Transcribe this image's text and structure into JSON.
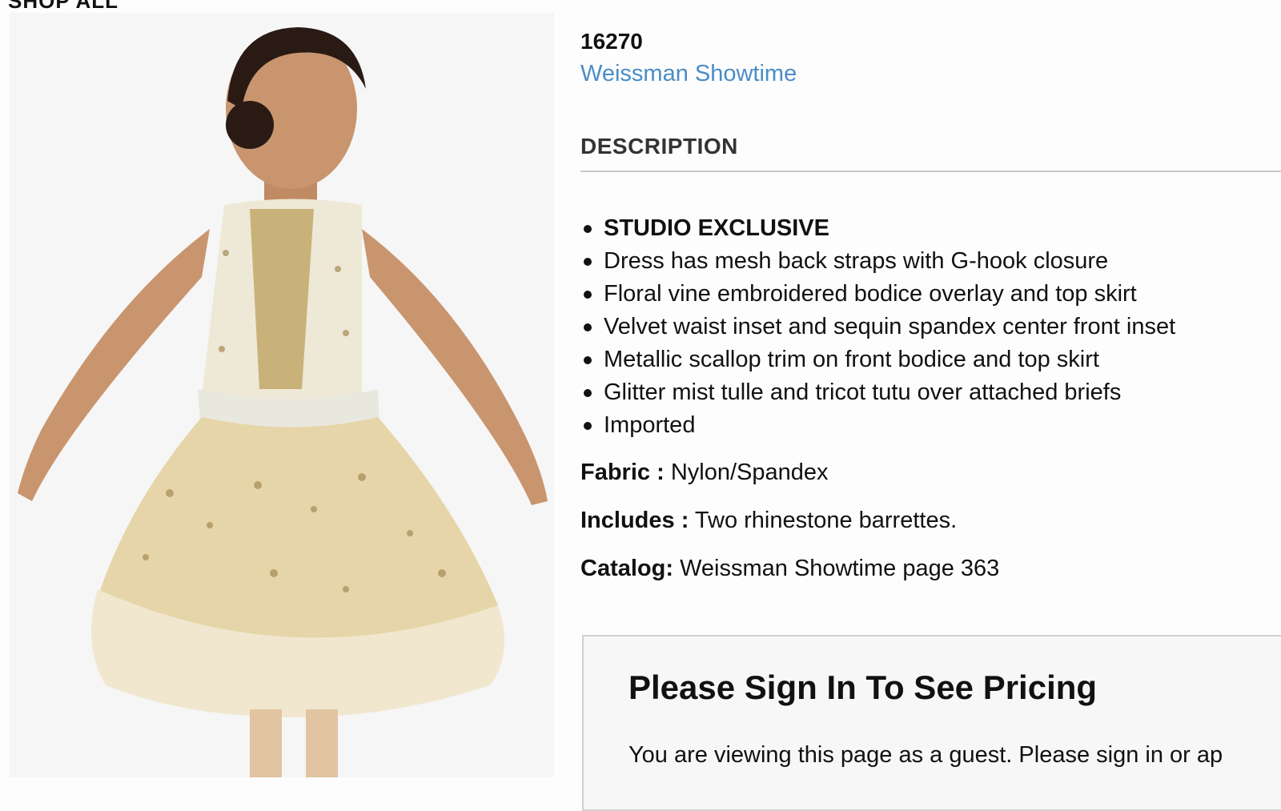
{
  "page": {
    "crumb": "SHOP ALL"
  },
  "product": {
    "sku": "16270",
    "brand": "Weissman Showtime",
    "image_alt": "Girl in cream and gold sequin ballet costume"
  },
  "description": {
    "heading": "DESCRIPTION",
    "bullets": [
      "STUDIO EXCLUSIVE",
      "Dress has mesh back straps with G-hook closure",
      "Floral vine embroidered bodice overlay and top skirt",
      "Velvet waist inset and sequin spandex center front inset",
      "Metallic scallop trim on front bodice and top skirt",
      "Glitter mist tulle and tricot tutu over attached briefs",
      "Imported"
    ]
  },
  "specs": {
    "fabric_label": "Fabric :",
    "fabric_value": "Nylon/Spandex",
    "includes_label": "Includes :",
    "includes_value": "Two rhinestone barrettes.",
    "catalog_label": "Catalog:",
    "catalog_value": "Weissman Showtime page 363"
  },
  "signin": {
    "title": "Please Sign In To See Pricing",
    "message": "You are viewing this page as a guest. Please sign in or ap"
  },
  "colors": {
    "link": "#4a8dc6",
    "text": "#111111",
    "divider": "#c8c8c8"
  }
}
